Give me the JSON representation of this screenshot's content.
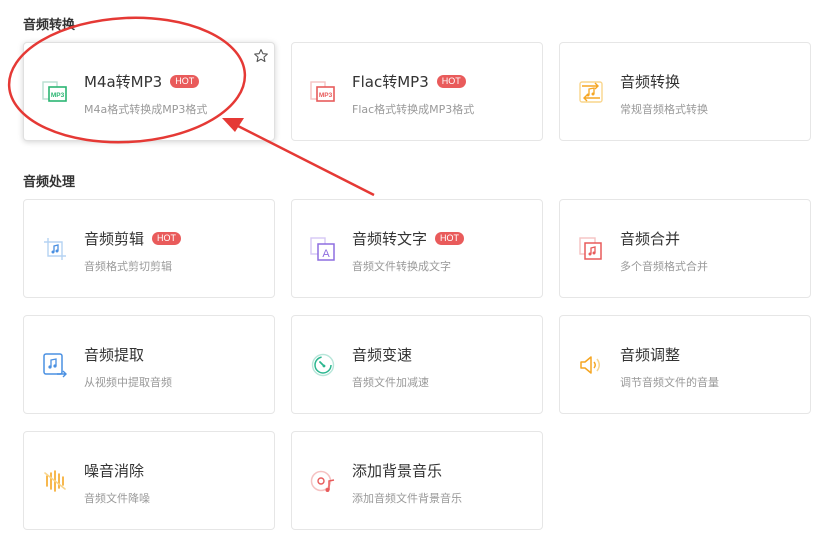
{
  "sections": {
    "conversion": {
      "title": "音频转换"
    },
    "processing": {
      "title": "音频处理"
    }
  },
  "cards": {
    "m4a_mp3": {
      "title": "M4a转MP3",
      "desc": "M4a格式转换成MP3格式",
      "badge": "HOT",
      "icon": "mp3-file-icon"
    },
    "flac_mp3": {
      "title": "Flac转MP3",
      "desc": "Flac格式转换成MP3格式",
      "badge": "HOT",
      "icon": "mp3-file-icon"
    },
    "audio_convert": {
      "title": "音频转换",
      "desc": "常规音频格式转换",
      "icon": "audio-convert-icon"
    },
    "audio_cut": {
      "title": "音频剪辑",
      "desc": "音频格式剪切剪辑",
      "badge": "HOT",
      "icon": "audio-crop-icon"
    },
    "audio_to_text": {
      "title": "音频转文字",
      "desc": "音频文件转换成文字",
      "badge": "HOT",
      "icon": "audio-text-icon"
    },
    "audio_merge": {
      "title": "音频合并",
      "desc": "多个音频格式合并",
      "icon": "audio-merge-icon"
    },
    "audio_extract": {
      "title": "音频提取",
      "desc": "从视频中提取音频",
      "icon": "audio-extract-icon"
    },
    "audio_speed": {
      "title": "音频变速",
      "desc": "音频文件加减速",
      "icon": "speed-gauge-icon"
    },
    "audio_volume": {
      "title": "音频调整",
      "desc": "调节音频文件的音量",
      "icon": "volume-icon"
    },
    "noise_remove": {
      "title": "噪音消除",
      "desc": "音频文件降噪",
      "icon": "noise-remove-icon"
    },
    "add_bgm": {
      "title": "添加背景音乐",
      "desc": "添加音频文件背景音乐",
      "icon": "bgm-disc-icon"
    }
  },
  "colors": {
    "hot_badge": "#e95b5b",
    "annotation_red": "#e53935"
  }
}
